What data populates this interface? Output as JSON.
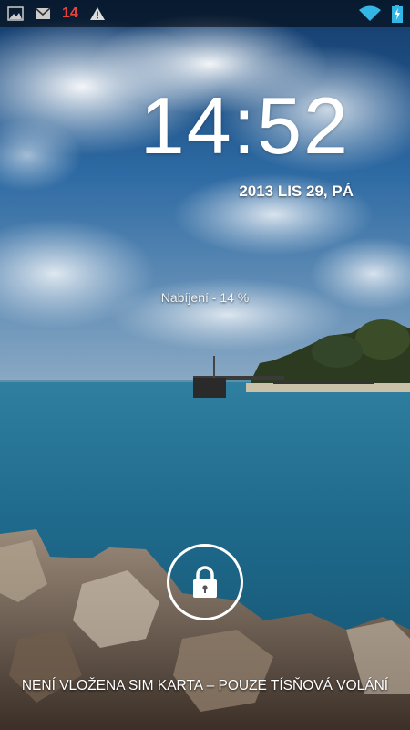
{
  "status_bar": {
    "notification_icons": [
      "gallery-icon",
      "gmail-icon",
      "warning-icon"
    ],
    "notification_count": "14",
    "system_icons": [
      "wifi-icon",
      "battery-charging-icon"
    ],
    "colors": {
      "notification_count": "#e8433b",
      "system_icons": "#33b5e5"
    }
  },
  "lockscreen": {
    "time": "14:52",
    "date": "2013 LIS 29, PÁ",
    "charging_status": "Nabíjení - 14 %",
    "unlock_icon": "lock-icon",
    "carrier_message": "NENÍ VLOŽENA SIM KARTA – POUZE TÍSŇOVÁ VOLÁNÍ"
  }
}
